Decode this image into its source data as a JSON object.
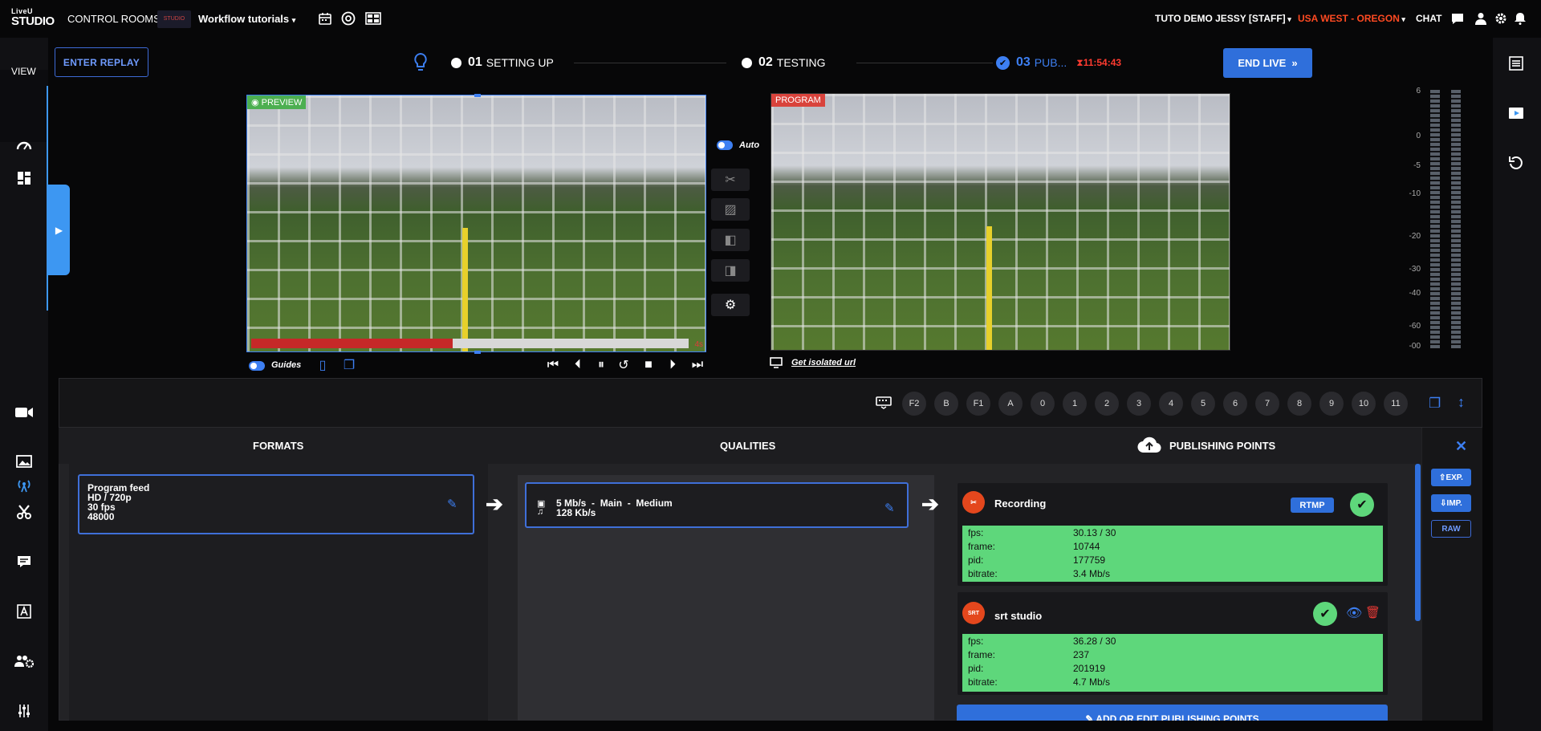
{
  "topbar": {
    "logo_top": "LiveU",
    "logo_bottom": "STUDIO",
    "control_rooms": "CONTROL ROOMS",
    "thumb_text": "STUDIO",
    "workflow": "Workflow tutorials",
    "user": "TUTO DEMO JESSY [STAFF]",
    "region": "USA WEST - OREGON",
    "chat": "CHAT"
  },
  "colors": {
    "accent": "#2f6fdb",
    "region": "#ff4a22",
    "status_green": "#5ed77b",
    "preview_label": "#4caf50",
    "program_label": "#d9433c"
  },
  "leftnav": {
    "view_label": "VIEW",
    "icons": [
      "dashboard-icon",
      "layout-icon",
      "camera-icon",
      "image-icon",
      "broadcast-icon",
      "tools-icon",
      "messages-icon",
      "text-icon",
      "users-gear-icon",
      "sliders-icon"
    ]
  },
  "header": {
    "enter_replay": "ENTER REPLAY",
    "steps": [
      {
        "num": "01",
        "label": "SETTING UP"
      },
      {
        "num": "02",
        "label": "TESTING"
      },
      {
        "num": "03",
        "label": "PUB..."
      }
    ],
    "timer": "11:54:43",
    "end_live": "END LIVE"
  },
  "preview": {
    "label": "PREVIEW",
    "progress": 0.46,
    "remaining": "4s"
  },
  "program": {
    "label": "PROGRAM"
  },
  "transition": {
    "auto_label": "Auto"
  },
  "preview_controls": {
    "guides_label": "Guides"
  },
  "program_controls": {
    "isolated_url": "Get isolated url"
  },
  "meter": {
    "labels": [
      "6",
      "0",
      "-5",
      "-10",
      "-20",
      "-30",
      "-40",
      "-60",
      "-00"
    ]
  },
  "keys": [
    "F2",
    "B",
    "F1",
    "A",
    "0",
    "1",
    "2",
    "3",
    "4",
    "5",
    "6",
    "7",
    "8",
    "9",
    "10",
    "11"
  ],
  "publish": {
    "formats_head": "FORMATS",
    "qualities_head": "QUALITIES",
    "points_head": "PUBLISHING POINTS",
    "format": {
      "name": "Program feed",
      "res": "HD / 720p",
      "fps": "30 fps",
      "rate": "48000"
    },
    "quality": {
      "video": "5 Mb/s",
      "profile": "Main",
      "preset": "Medium",
      "audio": "128 Kb/s"
    },
    "points": [
      {
        "name": "Recording",
        "badge": "RTMP",
        "icon": "SRT",
        "stats": [
          [
            "fps:",
            "30.13 / 30"
          ],
          [
            "frame:",
            "10744"
          ],
          [
            "pid:",
            "177759"
          ],
          [
            "bitrate:",
            "3.4 Mb/s"
          ]
        ]
      },
      {
        "name": "srt studio",
        "icon": "SRT",
        "stats": [
          [
            "fps:",
            "36.28 / 30"
          ],
          [
            "frame:",
            "237"
          ],
          [
            "pid:",
            "201919"
          ],
          [
            "bitrate:",
            "4.7 Mb/s"
          ]
        ]
      }
    ],
    "add_button": "ADD OR EDIT PUBLISHING POINTS",
    "exp": "EXP.",
    "imp": "IMP.",
    "raw": "RAW"
  }
}
